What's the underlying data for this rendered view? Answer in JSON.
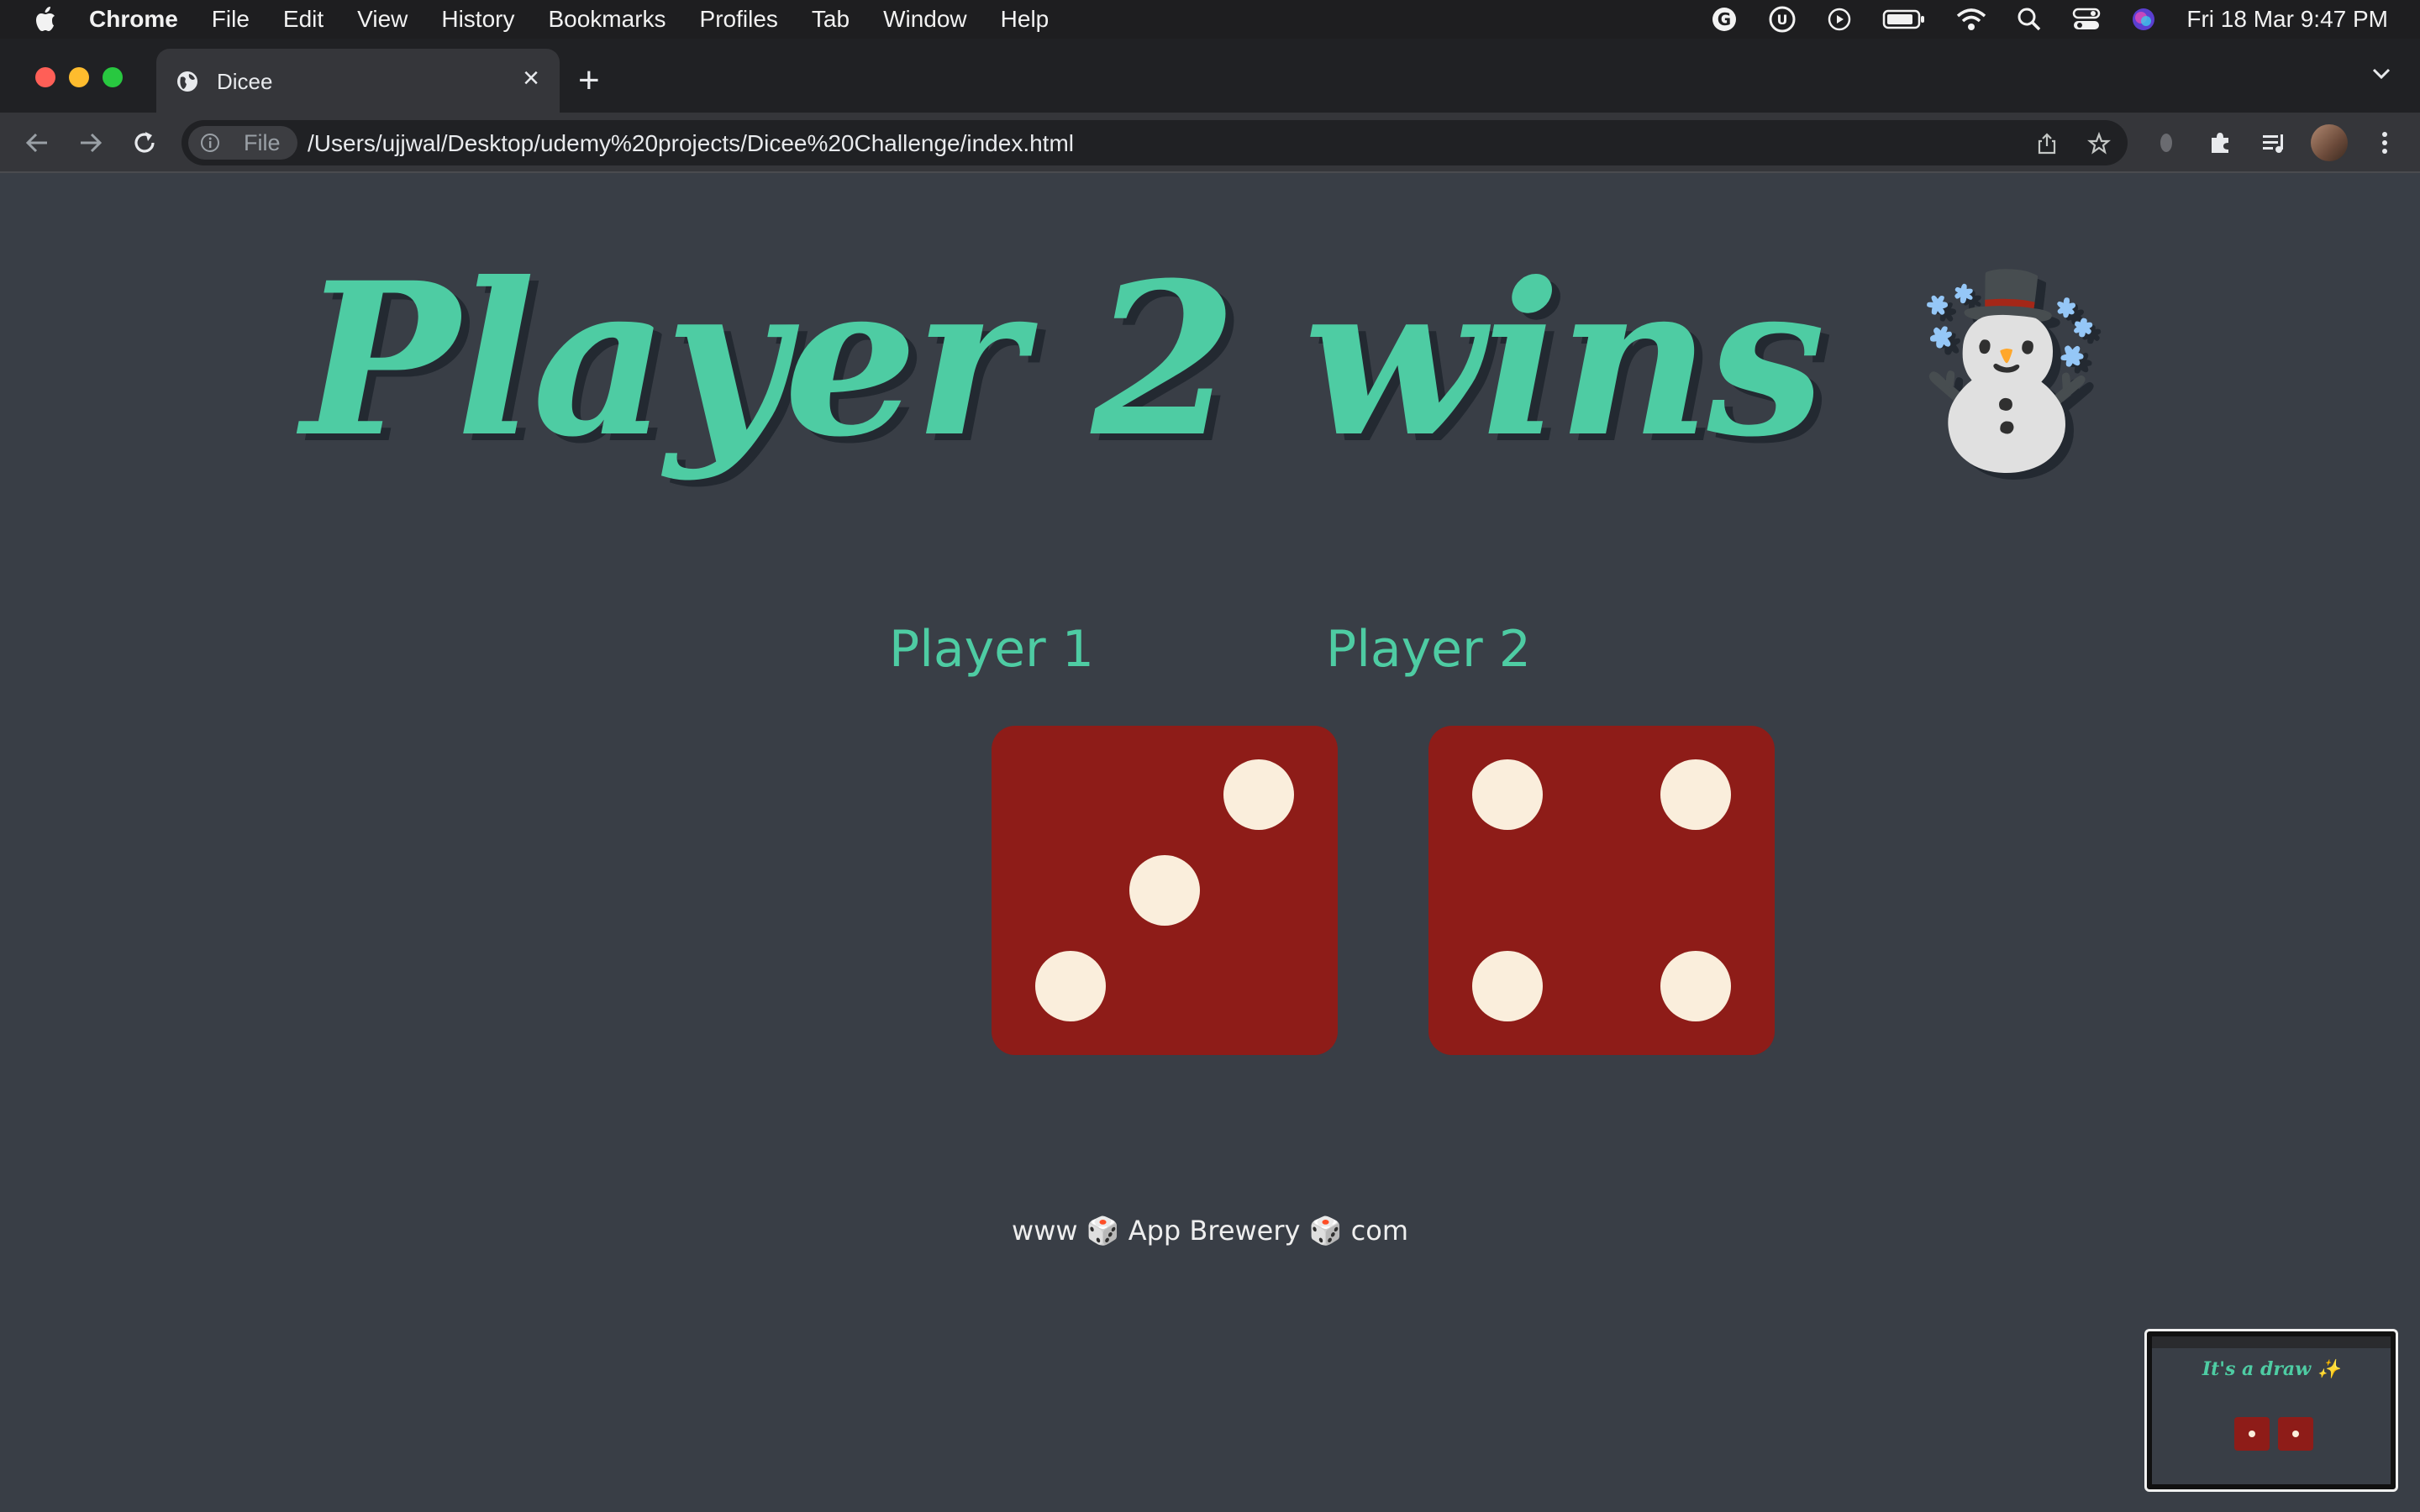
{
  "menubar": {
    "app_name": "Chrome",
    "menus": [
      "File",
      "Edit",
      "View",
      "History",
      "Bookmarks",
      "Profiles",
      "Tab",
      "Window",
      "Help"
    ],
    "clock": "Fri 18 Mar  9:47 PM"
  },
  "browser": {
    "tab_title": "Dicee",
    "tab_close": "×",
    "new_tab": "+",
    "security_chip": "File",
    "url": "/Users/ujjwal/Desktop/udemy%20projects/Dicee%20Challenge/index.html"
  },
  "page": {
    "heading": "Player 2 wins",
    "heading_emoji": "☃️",
    "players": [
      {
        "label": "Player 1",
        "die_value": 3
      },
      {
        "label": "Player 2",
        "die_value": 4
      }
    ],
    "footer": {
      "part1": "www",
      "dice_emoji": "🎲",
      "part2": "App Brewery",
      "part3": "com"
    },
    "colors": {
      "background": "#393E46",
      "accent": "#4ECCA3",
      "die": "#8E1C18",
      "pip": "#FAEEDC"
    }
  },
  "thumbnail": {
    "heading": "It's a draw ✨"
  }
}
